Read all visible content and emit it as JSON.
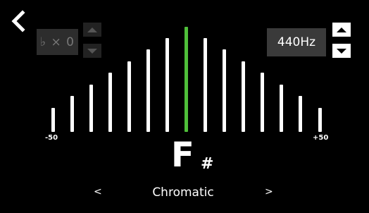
{
  "header": {
    "back_icon": "chevron-left-icon"
  },
  "flat": {
    "label": "♭ × 0",
    "up_icon": "triangle-up-icon",
    "down_icon": "triangle-down-icon"
  },
  "calibration": {
    "value": "440Hz",
    "up_icon": "triangle-up-icon",
    "down_icon": "triangle-down-icon"
  },
  "meter": {
    "min_label": "-50",
    "max_label": "+50",
    "needle_cents": 0,
    "colors": {
      "bar": "#ffffff",
      "center": "#4fbf3a"
    }
  },
  "note": {
    "name": "F",
    "accidental": "#"
  },
  "mode": {
    "prev": "<",
    "label": "Chromatic",
    "next": ">"
  }
}
